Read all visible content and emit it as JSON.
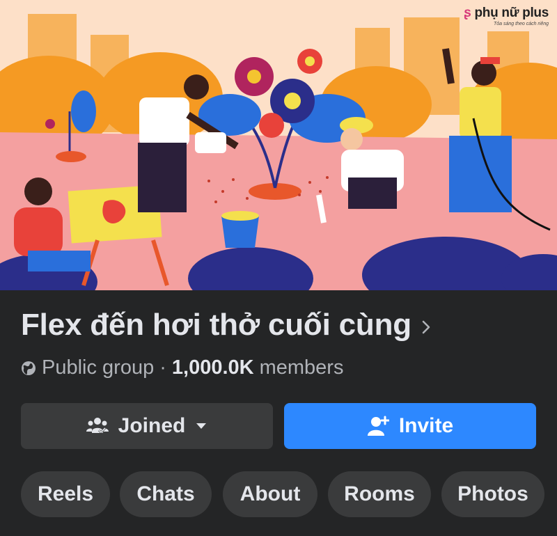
{
  "watermark": {
    "brand": "phụ nữ plus",
    "tagline": "Tỏa sáng theo cách riêng"
  },
  "group": {
    "name": "Flex đến hơi thở cuối cùng",
    "privacy": "Public group",
    "separator": "·",
    "member_count": "1,000.0K",
    "member_label": "members"
  },
  "actions": {
    "joined_label": "Joined",
    "invite_label": "Invite"
  },
  "tabs": [
    {
      "label": "Reels"
    },
    {
      "label": "Chats"
    },
    {
      "label": "About"
    },
    {
      "label": "Rooms"
    },
    {
      "label": "Photos"
    }
  ],
  "colors": {
    "background": "#242526",
    "button_secondary": "#3a3b3c",
    "button_primary": "#2d88ff",
    "text_primary": "#e4e6eb",
    "text_secondary": "#b0b3b8"
  },
  "icons": {
    "privacy": "globe-icon",
    "joined": "group-icon",
    "dropdown": "caret-down-icon",
    "invite": "add-person-icon",
    "title_chevron": "chevron-right-icon"
  }
}
